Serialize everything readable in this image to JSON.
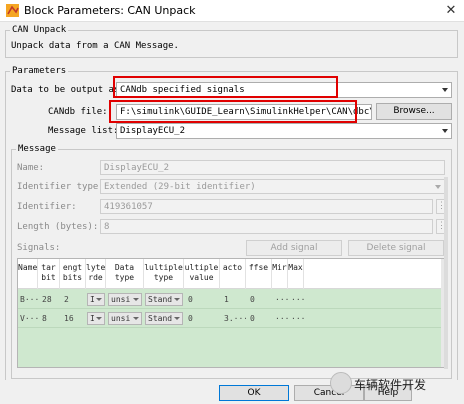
{
  "window": {
    "title": "Block Parameters: CAN Unpack",
    "close_glyph": "✕"
  },
  "block": {
    "group_title": "CAN Unpack",
    "description": "Unpack data from a CAN Message."
  },
  "parameters": {
    "group_title": "Parameters",
    "data_output_label": "Data to be output as:",
    "data_output_value": "CANdb specified signals",
    "candb_file_label": "CANdb file:",
    "candb_file_value": "F:\\simulink\\GUIDE_Learn\\SimulinkHelper\\CAN\\dbc\\H",
    "browse_label": "Browse...",
    "message_list_label": "Message list:",
    "message_list_value": "DisplayECU_2"
  },
  "message": {
    "group_title": "Message",
    "name_label": "Name:",
    "name_value": "DisplayECU_2",
    "identifier_type_label": "Identifier type:",
    "identifier_type_value": "Extended (29-bit identifier)",
    "identifier_label": "Identifier:",
    "identifier_value": "419361057",
    "length_label": "Length (bytes):",
    "length_value": "8",
    "dots": "⋮"
  },
  "signals": {
    "label": "Signals:",
    "add_label": "Add signal",
    "delete_label": "Delete signal",
    "columns": [
      {
        "top": "Name",
        "bottom": ""
      },
      {
        "top": "tar",
        "bottom": "bit"
      },
      {
        "top": "engt",
        "bottom": "bits"
      },
      {
        "top": "lyte",
        "bottom": "rde"
      },
      {
        "top": "Data",
        "bottom": "type"
      },
      {
        "top": "lultiple",
        "bottom": "type"
      },
      {
        "top": "ultiple",
        "bottom": "value"
      },
      {
        "top": "acto",
        "bottom": ""
      },
      {
        "top": "ffse",
        "bottom": ""
      },
      {
        "top": "Mir",
        "bottom": ""
      },
      {
        "top": "Max",
        "bottom": ""
      }
    ],
    "rows": [
      {
        "name": "B···",
        "start": "28",
        "length": "2",
        "byte_order": "I",
        "data_type": "unsi",
        "mux_type": "Stand",
        "mux_value": "0",
        "factor": "1",
        "offset": "0",
        "min": "···",
        "max": "···"
      },
      {
        "name": "V···",
        "start": "8",
        "length": "16",
        "byte_order": "I",
        "data_type": "unsi",
        "mux_type": "Stand",
        "mux_value": "0",
        "factor": "3.···",
        "offset": "0",
        "min": "···",
        "max": "···"
      }
    ]
  },
  "footer": {
    "ok_label": "OK",
    "cancel_label": "Cancel",
    "help_label": "Help",
    "watermark": "车辆软件开发"
  },
  "colors": {
    "highlight": "#e00000",
    "table_fill": "#cfe8cf"
  }
}
